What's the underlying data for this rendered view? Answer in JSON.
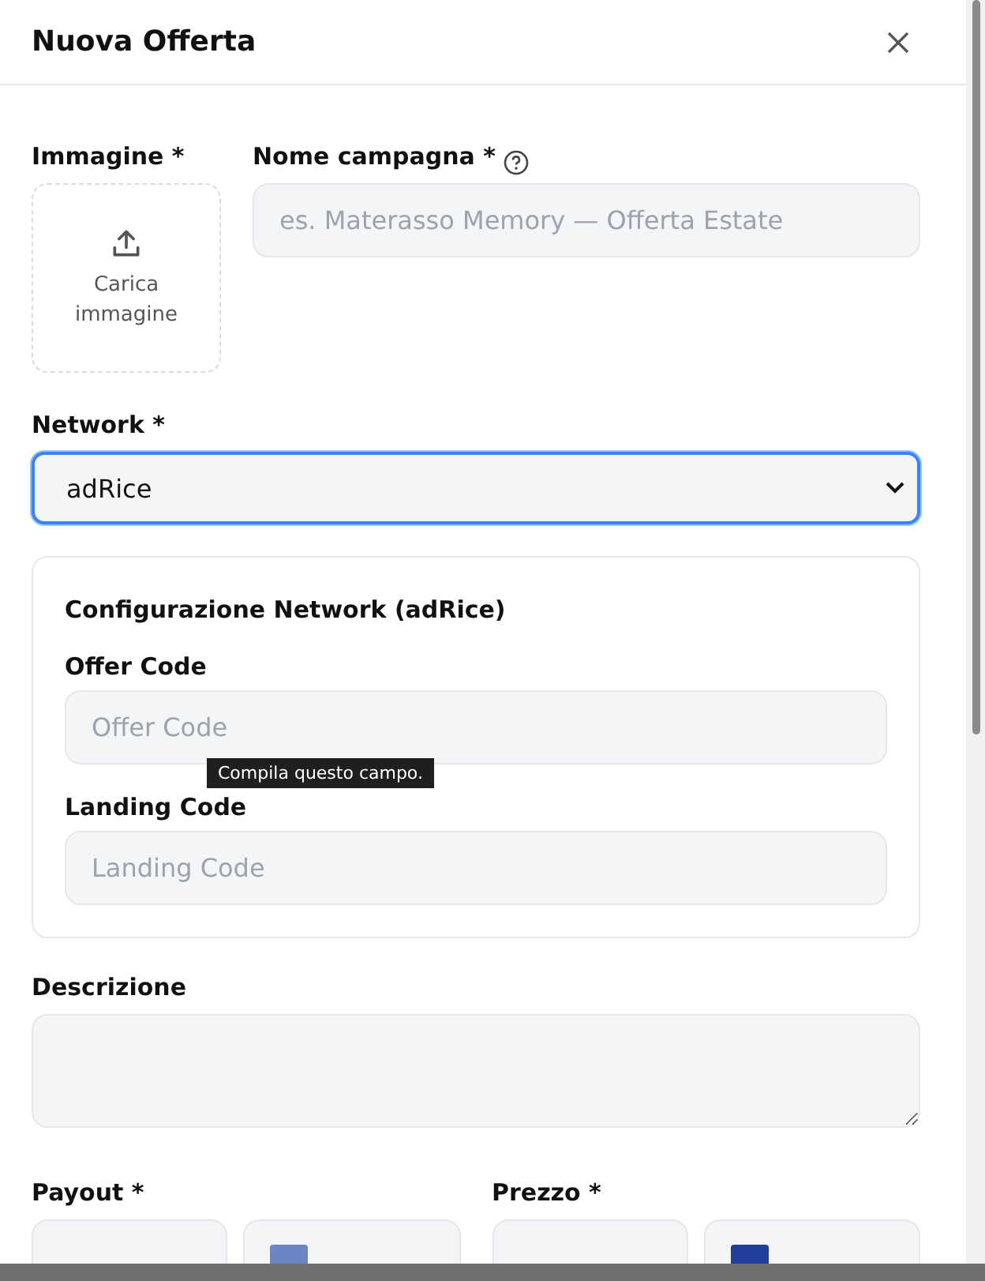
{
  "dialog": {
    "title": "Nuova Offerta"
  },
  "image_upload": {
    "label": "Immagine *",
    "button": "Carica immagine"
  },
  "campaign_name": {
    "label": "Nome campagna *",
    "placeholder": "es. Materasso Memory — Offerta Estate"
  },
  "network": {
    "label": "Network *",
    "value": "adRice",
    "focused": true
  },
  "network_config": {
    "title": "Configurazione Network (adRice)",
    "fields": [
      {
        "label": "Offer Code",
        "placeholder": "Offer Code",
        "tooltip": "Compila questo campo."
      },
      {
        "label": "Landing Code",
        "placeholder": "Landing Code"
      }
    ]
  },
  "description": {
    "label": "Descrizione"
  },
  "price_fields": [
    {
      "label": "Payout *",
      "color": "#6b86c4"
    },
    {
      "label": "Prezzo *",
      "color": "#1f3f9a"
    }
  ]
}
